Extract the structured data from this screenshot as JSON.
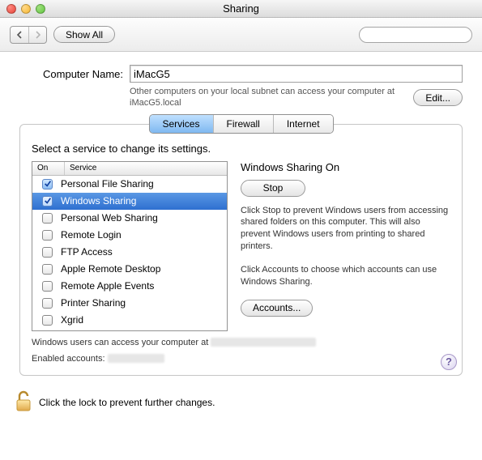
{
  "window": {
    "title": "Sharing"
  },
  "toolbar": {
    "show_all": "Show All"
  },
  "computer": {
    "label": "Computer Name:",
    "value": "iMacG5",
    "subtext": "Other computers on your local subnet can access your computer at iMacG5.local",
    "edit_label": "Edit..."
  },
  "tabs": {
    "services": "Services",
    "firewall": "Firewall",
    "internet": "Internet"
  },
  "instruction": "Select a service to change its settings.",
  "list": {
    "header_on": "On",
    "header_service": "Service",
    "items": [
      {
        "label": "Personal File Sharing",
        "on": true,
        "sel": false
      },
      {
        "label": "Windows Sharing",
        "on": true,
        "sel": true
      },
      {
        "label": "Personal Web Sharing",
        "on": false,
        "sel": false
      },
      {
        "label": "Remote Login",
        "on": false,
        "sel": false
      },
      {
        "label": "FTP Access",
        "on": false,
        "sel": false
      },
      {
        "label": "Apple Remote Desktop",
        "on": false,
        "sel": false
      },
      {
        "label": "Remote Apple Events",
        "on": false,
        "sel": false
      },
      {
        "label": "Printer Sharing",
        "on": false,
        "sel": false
      },
      {
        "label": "Xgrid",
        "on": false,
        "sel": false
      }
    ]
  },
  "detail": {
    "title": "Windows Sharing On",
    "stop_label": "Stop",
    "desc": "Click Stop to prevent Windows users from accessing shared folders on this computer. This will also prevent Windows users from printing to shared printers.",
    "accounts_hint": "Click Accounts to choose which accounts can use Windows Sharing.",
    "accounts_label": "Accounts..."
  },
  "status": {
    "access_prefix": "Windows users can access your computer at",
    "enabled_prefix": "Enabled accounts:"
  },
  "help_label": "?",
  "lock": {
    "text": "Click the lock to prevent further changes."
  }
}
